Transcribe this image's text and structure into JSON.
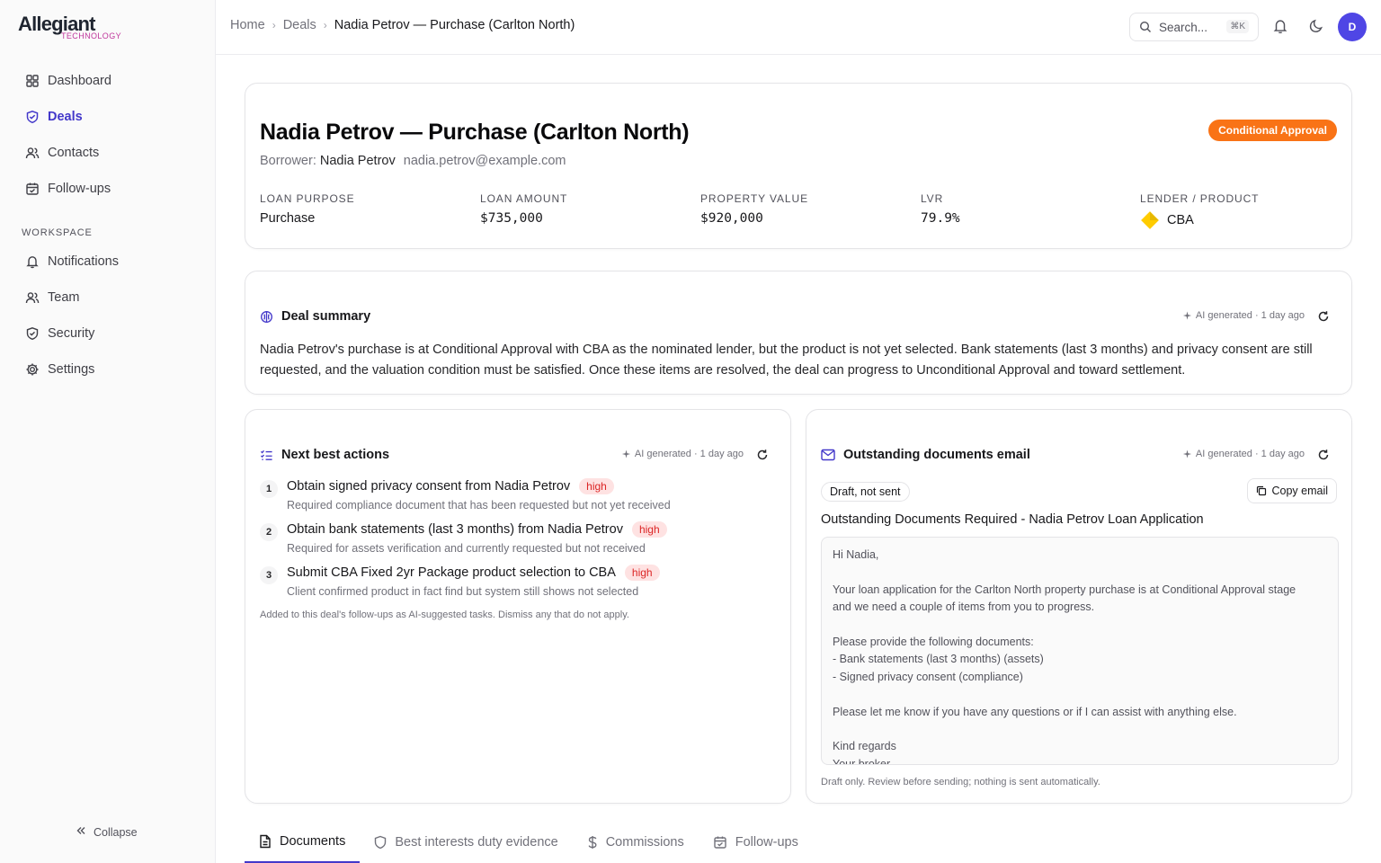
{
  "brand": {
    "name": "Allegiant",
    "tagline": "TECHNOLOGY"
  },
  "sidebar": {
    "main_items": [
      {
        "label": "Dashboard",
        "icon": "grid-icon",
        "active": false
      },
      {
        "label": "Deals",
        "icon": "shield-handshake-icon",
        "active": true
      },
      {
        "label": "Contacts",
        "icon": "users-icon",
        "active": false
      },
      {
        "label": "Follow-ups",
        "icon": "calendar-check-icon",
        "active": false
      }
    ],
    "workspace_heading": "WORKSPACE",
    "workspace_items": [
      {
        "label": "Notifications",
        "icon": "bell-icon"
      },
      {
        "label": "Team",
        "icon": "users-icon"
      },
      {
        "label": "Security",
        "icon": "shield-icon"
      },
      {
        "label": "Settings",
        "icon": "gear-icon"
      }
    ],
    "collapse_label": "Collapse"
  },
  "topbar": {
    "breadcrumb": [
      "Home",
      "Deals",
      "Nadia Petrov — Purchase (Carlton North)"
    ],
    "search_placeholder": "Search...",
    "search_shortcut": "⌘K",
    "avatar_initial": "D"
  },
  "deal": {
    "title": "Nadia Petrov — Purchase (Carlton North)",
    "status": "Conditional Approval",
    "status_color": "#f97316",
    "borrower_label": "Borrower:",
    "borrower_name": "Nadia Petrov",
    "borrower_email": "nadia.petrov@example.com",
    "metrics": [
      {
        "label": "LOAN PURPOSE",
        "value": "Purchase"
      },
      {
        "label": "LOAN AMOUNT",
        "value": "$735,000"
      },
      {
        "label": "PROPERTY VALUE",
        "value": "$920,000"
      },
      {
        "label": "LVR",
        "value": "79.9%"
      },
      {
        "label": "LENDER / PRODUCT",
        "value": "CBA"
      }
    ]
  },
  "summary": {
    "title": "Deal summary",
    "ai_meta": "AI generated · 1 day ago",
    "text": "Nadia Petrov's purchase is at Conditional Approval with CBA as the nominated lender, but the product is not yet selected. Bank statements (last 3 months) and privacy consent are still requested, and the valuation condition must be satisfied. Once these items are resolved, the deal can progress to Unconditional Approval and toward settlement."
  },
  "actions": {
    "title": "Next best actions",
    "ai_meta": "AI generated · 1 day ago",
    "items": [
      {
        "num": "1",
        "title": "Obtain signed privacy consent from Nadia Petrov",
        "priority": "high",
        "subtitle": "Required compliance document that has been requested but not yet received"
      },
      {
        "num": "2",
        "title": "Obtain bank statements (last 3 months) from Nadia Petrov",
        "priority": "high",
        "subtitle": "Required for assets verification and currently requested but not received"
      },
      {
        "num": "3",
        "title": "Submit CBA Fixed 2yr Package product selection to CBA",
        "priority": "high",
        "subtitle": "Client confirmed product in fact find but system still shows not selected"
      }
    ],
    "footnote": "Added to this deal's follow-ups as AI-suggested tasks. Dismiss any that do not apply."
  },
  "email": {
    "title": "Outstanding documents email",
    "ai_meta": "AI generated · 1 day ago",
    "status": "Draft, not sent",
    "copy_label": "Copy email",
    "subject": "Outstanding Documents Required - Nadia Petrov Loan Application",
    "body_lines": [
      "Hi Nadia,",
      "",
      "Your loan application for the Carlton North property purchase is at Conditional Approval stage",
      "and we need a couple of items from you to progress.",
      "",
      "Please provide the following documents:",
      "- Bank statements (last 3 months) (assets)",
      "- Signed privacy consent (compliance)",
      "",
      "Please let me know if you have any questions or if I can assist with anything else.",
      "",
      "Kind regards",
      "Your broker"
    ],
    "footnote": "Draft only. Review before sending; nothing is sent automatically."
  },
  "tabs": [
    {
      "label": "Documents",
      "icon": "document-icon",
      "active": true
    },
    {
      "label": "Best interests duty evidence",
      "icon": "shield-icon",
      "active": false
    },
    {
      "label": "Commissions",
      "icon": "dollar-icon",
      "active": false
    },
    {
      "label": "Follow-ups",
      "icon": "calendar-check-icon",
      "active": false
    }
  ],
  "colors": {
    "accent": "#4338ca",
    "status": "#f97316",
    "priority_bg": "#fee2e2",
    "priority_text": "#dc2626"
  }
}
